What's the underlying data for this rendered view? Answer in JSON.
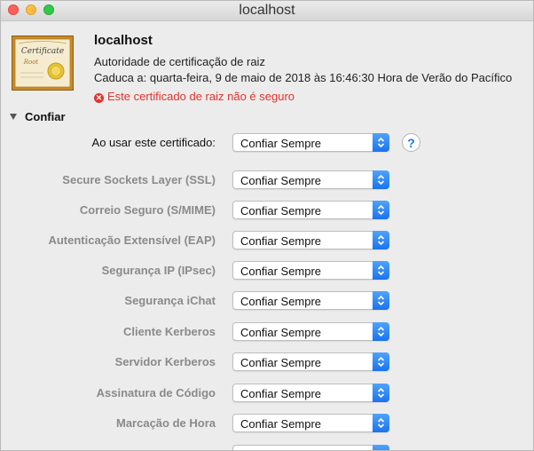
{
  "window": {
    "title": "localhost"
  },
  "certificate": {
    "name": "localhost",
    "kind": "Autoridade de certificação de raiz",
    "expires": "Caduca a: quarta-feira, 9 de maio de 2018 às 16:46:30 Hora de Verão do Pacífico",
    "warning": "Este certificado de raiz não é seguro",
    "icon_text_top": "Certificate",
    "icon_text_bottom": "Root"
  },
  "trust": {
    "section_label": "Confiar",
    "main": {
      "label": "Ao usar este certificado:",
      "value": "Confiar Sempre"
    },
    "help_label": "?",
    "items": [
      {
        "label": "Secure Sockets Layer (SSL)",
        "value": "Confiar Sempre"
      },
      {
        "label": "Correio Seguro (S/MIME)",
        "value": "Confiar Sempre"
      },
      {
        "label": "Autenticação Extensível (EAP)",
        "value": "Confiar Sempre"
      },
      {
        "label": "Segurança IP (IPsec)",
        "value": "Confiar Sempre"
      },
      {
        "label": "Segurança iChat",
        "value": "Confiar Sempre"
      },
      {
        "label": "Cliente Kerberos",
        "value": "Confiar Sempre"
      },
      {
        "label": "Servidor Kerberos",
        "value": "Confiar Sempre"
      },
      {
        "label": "Assinatura de Código",
        "value": "Confiar Sempre"
      },
      {
        "label": "Marcação de Hora",
        "value": "Confiar Sempre"
      }
    ]
  },
  "colors": {
    "warning": "#e2332b",
    "accent": "#1a73f0"
  },
  "icons": {
    "warning": "x-circle-icon",
    "disclosure": "disclosure-triangle-icon",
    "popup": "up-down-chevron-icon",
    "certificate": "certificate-icon"
  }
}
